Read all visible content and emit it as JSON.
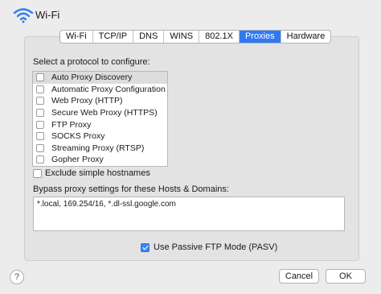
{
  "window": {
    "title": "Wi-Fi",
    "icon": "wifi-icon"
  },
  "tabs": [
    {
      "label": "Wi-Fi",
      "selected": false
    },
    {
      "label": "TCP/IP",
      "selected": false
    },
    {
      "label": "DNS",
      "selected": false
    },
    {
      "label": "WINS",
      "selected": false
    },
    {
      "label": "802.1X",
      "selected": false
    },
    {
      "label": "Proxies",
      "selected": true
    },
    {
      "label": "Hardware",
      "selected": false
    }
  ],
  "select_label": "Select a protocol to configure:",
  "protocols": [
    {
      "label": "Auto Proxy Discovery",
      "checked": false,
      "selected": true
    },
    {
      "label": "Automatic Proxy Configuration",
      "checked": false
    },
    {
      "label": "Web Proxy (HTTP)",
      "checked": false
    },
    {
      "label": "Secure Web Proxy (HTTPS)",
      "checked": false
    },
    {
      "label": "FTP Proxy",
      "checked": false
    },
    {
      "label": "SOCKS Proxy",
      "checked": false
    },
    {
      "label": "Streaming Proxy (RTSP)",
      "checked": false
    },
    {
      "label": "Gopher Proxy",
      "checked": false
    }
  ],
  "exclude_simple": {
    "label": "Exclude simple hostnames",
    "checked": false
  },
  "bypass": {
    "label": "Bypass proxy settings for these Hosts & Domains:",
    "value": "*.local, 169.254/16, *.dl-ssl.google.com"
  },
  "pasv": {
    "label": "Use Passive FTP Mode (PASV)",
    "checked": true
  },
  "buttons": {
    "help": "?",
    "cancel": "Cancel",
    "ok": "OK"
  },
  "colors": {
    "accent": "#2f7af2",
    "background": "#ececec"
  }
}
